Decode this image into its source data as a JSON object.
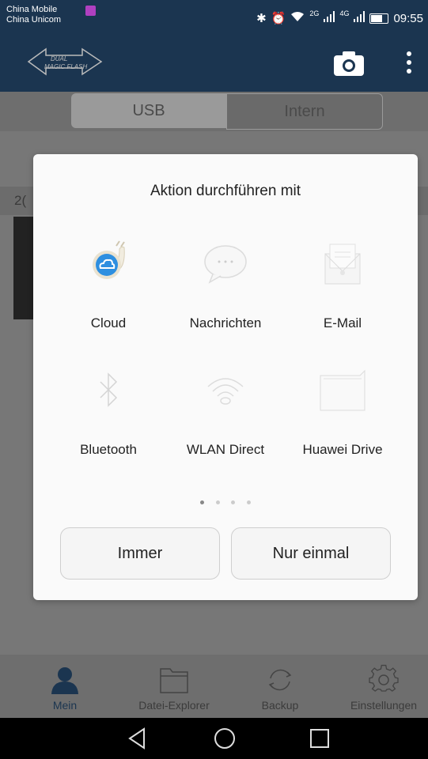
{
  "status_bar": {
    "carrier_1": "China Mobile",
    "carrier_2": "China Unicom",
    "net_2g": "2G",
    "net_4g": "4G",
    "time": "09:55"
  },
  "app_bar": {
    "logo_line1": "DUAL",
    "logo_line2": "MAGIC FLASH",
    "camera_icon": "camera-icon",
    "menu_icon": "more-vert-icon"
  },
  "segment": {
    "usb_label": "USB",
    "intern_label": "Intern"
  },
  "background": {
    "date_fragment": "2("
  },
  "dialog": {
    "title": "Aktion durchführen mit",
    "apps": [
      {
        "label": "Cloud",
        "icon": "cloud-snail-icon"
      },
      {
        "label": "Nachrichten",
        "icon": "message-bubble-icon"
      },
      {
        "label": "E-Mail",
        "icon": "email-envelope-icon"
      },
      {
        "label": "Bluetooth",
        "icon": "bluetooth-icon"
      },
      {
        "label": "WLAN Direct",
        "icon": "wifi-direct-icon"
      },
      {
        "label": "Huawei Drive",
        "icon": "folder-icon"
      }
    ],
    "page_indicator": {
      "current": 1,
      "total": 4
    },
    "buttons": {
      "always": "Immer",
      "once": "Nur einmal"
    }
  },
  "tab_bar": {
    "tabs": [
      {
        "label": "Mein",
        "icon": "person-icon",
        "active": true
      },
      {
        "label": "Datei-Explorer",
        "icon": "folder-icon",
        "active": false
      },
      {
        "label": "Backup",
        "icon": "sync-icon",
        "active": false
      },
      {
        "label": "Einstellungen",
        "icon": "gear-icon",
        "active": false
      }
    ]
  },
  "colors": {
    "header": "#1b3550",
    "accent_blue": "#2e8fe0",
    "dim_overlay": "#777777"
  }
}
